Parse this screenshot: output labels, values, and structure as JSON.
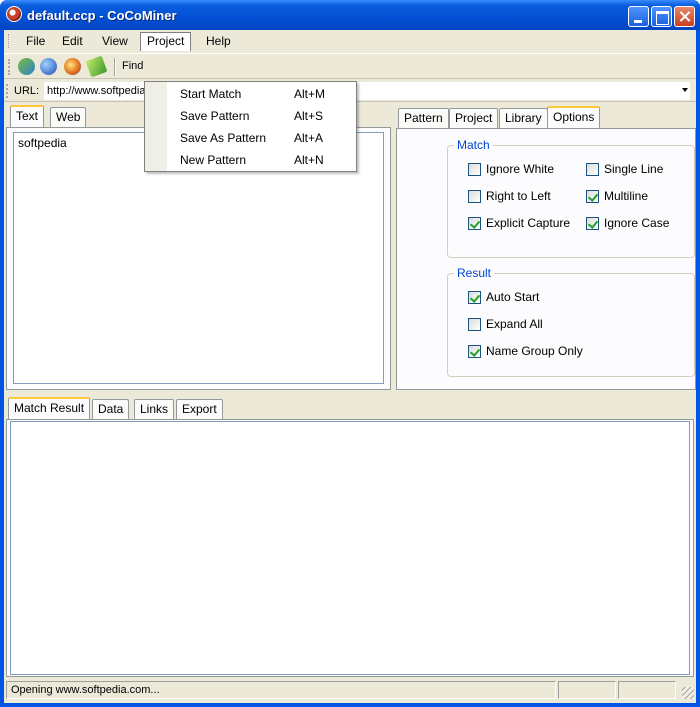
{
  "window": {
    "title": "default.ccp - CoCoMiner"
  },
  "menubar": {
    "items": [
      "File",
      "Edit",
      "View",
      "Project",
      "Help"
    ]
  },
  "toolbar": {
    "find_label": "Find",
    "icons": [
      "open-icon",
      "globe-icon",
      "firefox-icon",
      "scissors-icon"
    ]
  },
  "urlbar": {
    "label": "URL:",
    "value": "http://www.softpedia.com"
  },
  "project_menu": {
    "items": [
      {
        "label": "Start Match",
        "shortcut": "Alt+M"
      },
      {
        "label": "Save Pattern",
        "shortcut": "Alt+S"
      },
      {
        "label": "Save As Pattern",
        "shortcut": "Alt+A"
      },
      {
        "label": "New Pattern",
        "shortcut": "Alt+N"
      }
    ]
  },
  "left_tabs": {
    "items": [
      "Text",
      "Web"
    ],
    "selected": "Text"
  },
  "text_area": {
    "value": "softpedia"
  },
  "right_tabs": {
    "items": [
      "Pattern",
      "Project",
      "Library",
      "Options"
    ],
    "selected": "Options"
  },
  "options": {
    "match_group": {
      "title": "Match",
      "items": [
        {
          "label": "Ignore White",
          "checked": false
        },
        {
          "label": "Single Line",
          "checked": false
        },
        {
          "label": "Right to Left",
          "checked": false
        },
        {
          "label": "Multiline",
          "checked": true
        },
        {
          "label": "Explicit Capture",
          "checked": true
        },
        {
          "label": "Ignore Case",
          "checked": true
        }
      ]
    },
    "result_group": {
      "title": "Result",
      "items": [
        {
          "label": "Auto Start",
          "checked": true
        },
        {
          "label": "Expand All",
          "checked": false
        },
        {
          "label": "Name Group Only",
          "checked": true
        }
      ]
    }
  },
  "bottom_tabs": {
    "items": [
      "Match Result",
      "Data",
      "Links",
      "Export"
    ],
    "selected": "Match Result"
  },
  "status": {
    "text": "Opening www.softpedia.com..."
  },
  "colors": {
    "titlebar": "#0350d6",
    "face": "#ece9d8",
    "group_title": "#0046d5",
    "tab_highlight": "#ffc83c",
    "check": "#21a121"
  }
}
